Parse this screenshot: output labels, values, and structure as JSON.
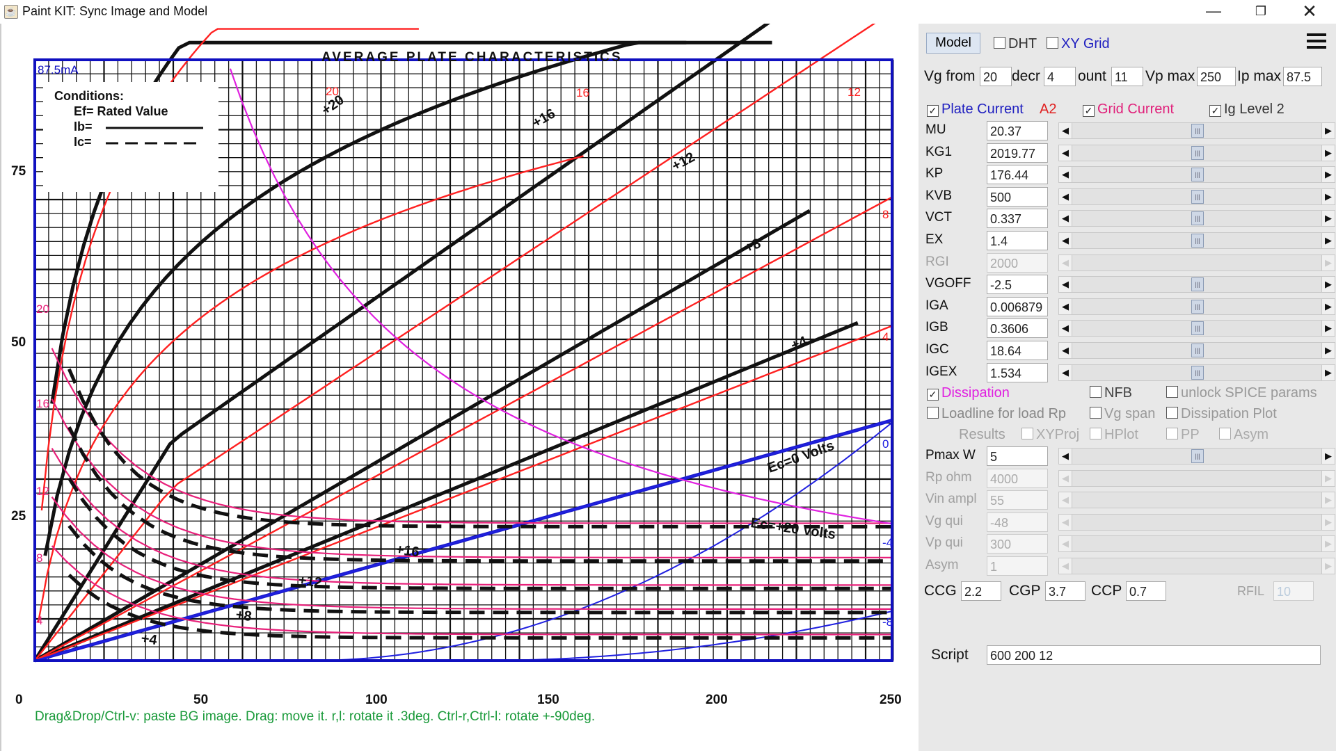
{
  "window": {
    "title": "Paint KIT: Sync Image and Model",
    "minimize": "—",
    "maximize": "❐",
    "close": "✕"
  },
  "plot": {
    "chart_title": "AVERAGE PLATE CHARACTERISTICS",
    "x_ticks": [
      "0",
      "50",
      "100",
      "150",
      "200",
      "250"
    ],
    "y_ticks": [
      "75",
      "50",
      "25"
    ],
    "corner_label": "87.5mA",
    "conditions": [
      "Conditions:",
      "Ef= Rated Value",
      "Ib=",
      "Ic="
    ],
    "plate_labels": [
      "+20",
      "+16",
      "+12",
      "+8",
      "+4",
      "Ec=0 Volts"
    ],
    "grid_labels": [
      "Ec=+20 Volts",
      "+16",
      "+12",
      "+8",
      "+4"
    ],
    "model_right_labels": [
      "20",
      "16",
      "12",
      "8",
      "4",
      "0",
      "-4",
      "-8"
    ],
    "model_left_labels": [
      "20",
      "16",
      "12",
      "8",
      "4"
    ],
    "status": "Drag&Drop/Ctrl-v: paste BG image. Drag: move it. r,l: rotate it .3deg. Ctrl-r,Ctrl-l: rotate +-90deg."
  },
  "toolbar": {
    "model_button": "Model",
    "dht": "DHT",
    "xy_grid": "XY Grid",
    "vg_from_label": "Vg from",
    "vg_from": "20",
    "decr_label": "decr",
    "decr": "4",
    "count_label": "ount",
    "count": "11",
    "vp_max_label": "Vp max",
    "vp_max": "250",
    "ip_max_label": "Ip max",
    "ip_max": "87.5"
  },
  "checks": {
    "plate_current": "Plate Current",
    "a2": "A2",
    "grid_current": "Grid Current",
    "ig_level2": "Ig Level 2"
  },
  "params": [
    {
      "name": "MU",
      "value": "20.37"
    },
    {
      "name": "KG1",
      "value": "2019.77"
    },
    {
      "name": "KP",
      "value": "176.44"
    },
    {
      "name": "KVB",
      "value": "500"
    },
    {
      "name": "VCT",
      "value": "0.337"
    },
    {
      "name": "EX",
      "value": "1.4"
    },
    {
      "name": "RGI",
      "value": "2000"
    },
    {
      "name": "VGOFF",
      "value": "-2.5"
    },
    {
      "name": "IGA",
      "value": "0.006879"
    },
    {
      "name": "IGB",
      "value": "0.3606"
    },
    {
      "name": "IGC",
      "value": "18.64"
    },
    {
      "name": "IGEX",
      "value": "1.534"
    }
  ],
  "options": {
    "dissipation": "Dissipation",
    "nfb": "NFB",
    "unlock_spice": "unlock SPICE params",
    "loadline": "Loadline for load Rp",
    "vg_span": "Vg span",
    "dissipation_plot": "Dissipation Plot",
    "results": "Results",
    "xyproj": "XYProj",
    "hplot": "HPlot",
    "pp": "PP",
    "asym": "Asym"
  },
  "loadparams": [
    {
      "name": "Pmax W",
      "value": "5"
    },
    {
      "name": "Rp ohm",
      "value": "4000"
    },
    {
      "name": "Vin ampl",
      "value": "55"
    },
    {
      "name": "Vg qui",
      "value": "-48"
    },
    {
      "name": "Vp qui",
      "value": "300"
    },
    {
      "name": "Asym",
      "value": "1"
    }
  ],
  "caps": {
    "ccg_label": "CCG",
    "ccg": "2.2",
    "cgp_label": "CGP",
    "cgp": "3.7",
    "ccp_label": "CCP",
    "ccp": "0.7",
    "rfil_label": "RFIL",
    "rfil": "10"
  },
  "script": {
    "label": "Script",
    "value": "600 200 12"
  },
  "colors": {
    "grid": "#111111",
    "model_plate": "#ff1a1a",
    "model_grid": "#e8207a",
    "model_neg": "#2020e0",
    "dissipation": "#e020e0",
    "frame": "#1010c0",
    "status": "#1a9a3a"
  }
}
